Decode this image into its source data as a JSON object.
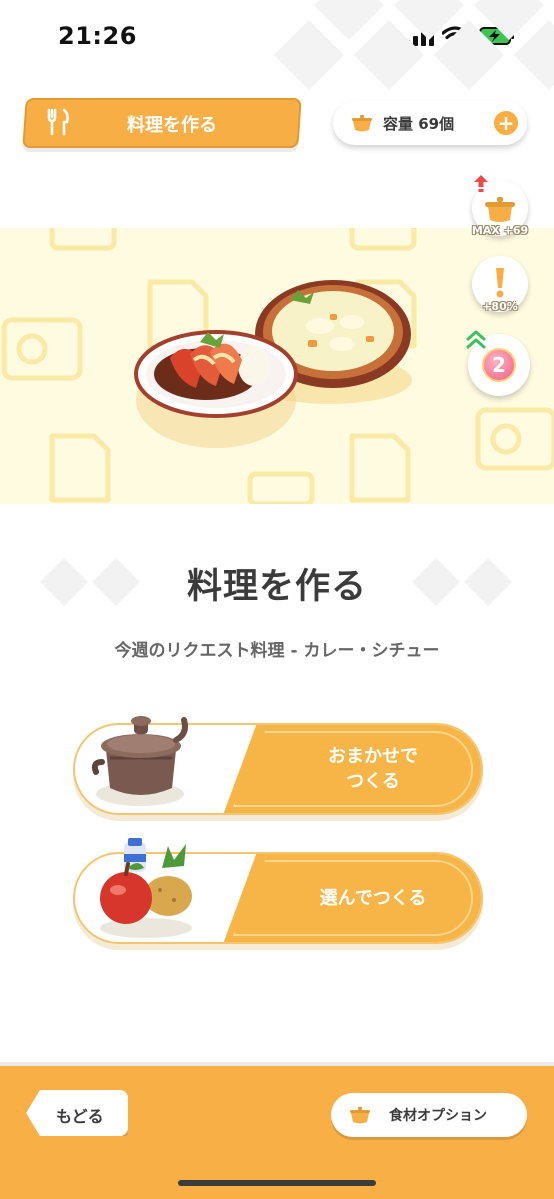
{
  "status_bar": {
    "time": "21:26"
  },
  "header": {
    "title": "料理を作る",
    "capacity_label": "容量 69個",
    "add_label": "+"
  },
  "buffs": [
    {
      "icon": "pot-icon",
      "caption": "MAX +69"
    },
    {
      "icon": "exclamation-icon",
      "caption": "+80%"
    },
    {
      "icon": "level-badge-icon",
      "value": "2"
    }
  ],
  "main": {
    "title": "料理を作る",
    "subtitle": "今週のリクエスト料理 - カレー・シチュー"
  },
  "actions": [
    {
      "label": "おまかせで\nつくる",
      "icon": "cooking-pot-icon"
    },
    {
      "label": "選んでつくる",
      "icon": "ingredients-icon"
    }
  ],
  "footer": {
    "back_label": "もどる",
    "option_label": "食材オプション"
  },
  "colors": {
    "accent": "#f7ae44",
    "hero_background": "#fffbe0",
    "level_badge": "#ef5f83"
  }
}
